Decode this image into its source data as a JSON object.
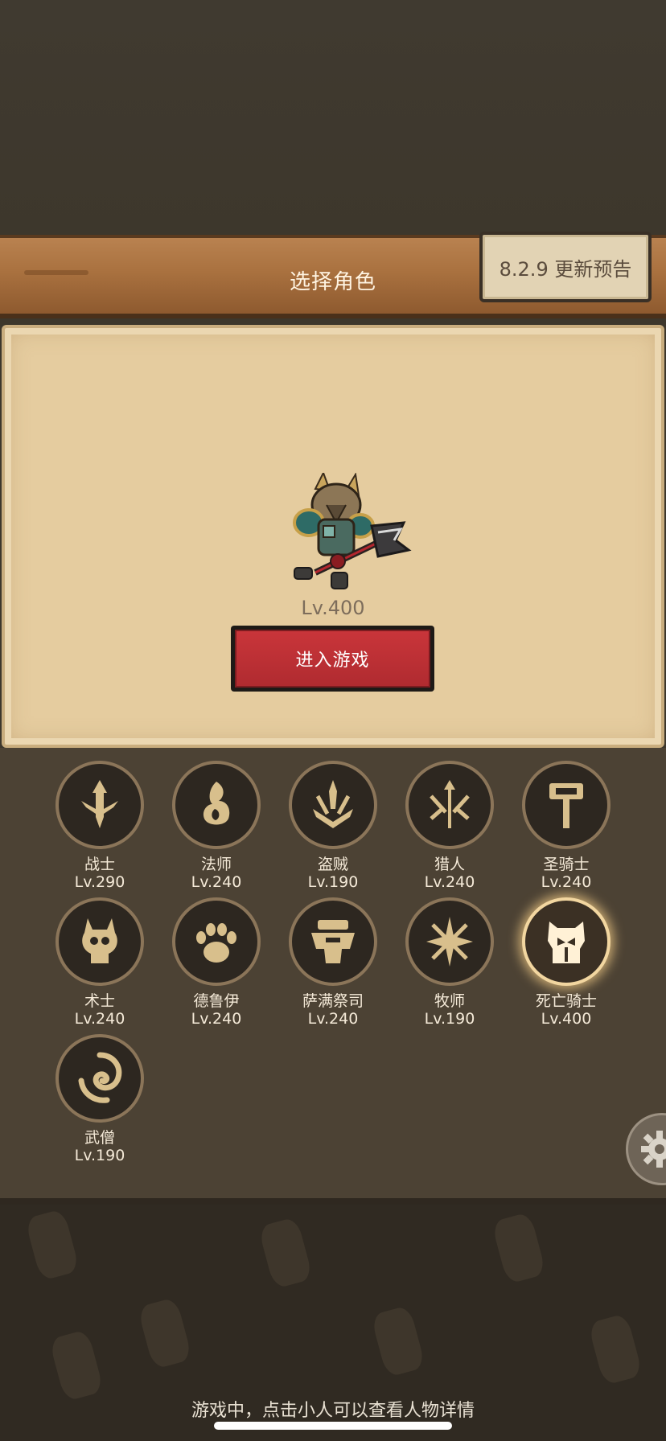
{
  "header": {
    "title": "选择角色",
    "update_button_label": "8.2.9 更新预告"
  },
  "selected_hero": {
    "level": "Lv.400",
    "enter_button_label": "进入游戏"
  },
  "classes": [
    {
      "name": "战士",
      "level": "Lv.290",
      "icon": "warrior-sword-icon"
    },
    {
      "name": "法师",
      "level": "Lv.240",
      "icon": "mage-flame-icon"
    },
    {
      "name": "盗贼",
      "level": "Lv.190",
      "icon": "rogue-daggers-icon"
    },
    {
      "name": "猎人",
      "level": "Lv.240",
      "icon": "hunter-arrows-icon"
    },
    {
      "name": "圣骑士",
      "level": "Lv.240",
      "icon": "paladin-hammer-icon"
    },
    {
      "name": "术士",
      "level": "Lv.240",
      "icon": "warlock-skull-icon"
    },
    {
      "name": "德鲁伊",
      "level": "Lv.240",
      "icon": "druid-paw-icon"
    },
    {
      "name": "萨满祭司",
      "level": "Lv.240",
      "icon": "shaman-totem-icon"
    },
    {
      "name": "牧师",
      "level": "Lv.190",
      "icon": "priest-star-icon"
    },
    {
      "name": "死亡骑士",
      "level": "Lv.400",
      "icon": "death-knight-helm-icon",
      "selected": true
    },
    {
      "name": "武僧",
      "level": "Lv.190",
      "icon": "monk-swirl-icon"
    }
  ],
  "footer": {
    "hint": "游戏中，点击小人可以查看人物详情"
  },
  "colors": {
    "accent_red": "#c9353a",
    "parchment": "#e5cc9f",
    "icon_gold": "#d8bf8c"
  }
}
